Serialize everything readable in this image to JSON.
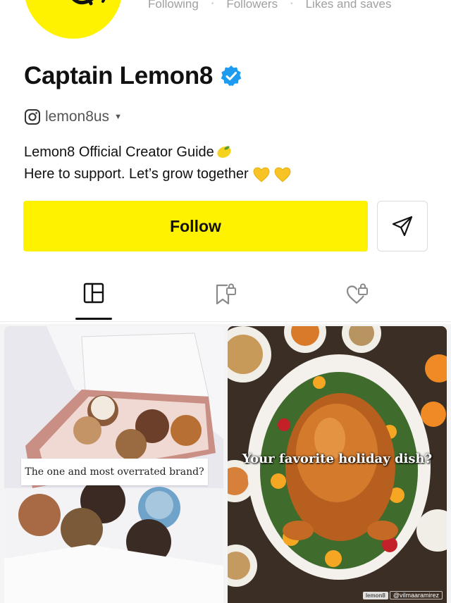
{
  "profile": {
    "name": "Captain Lemon8",
    "handle": "lemon8us",
    "bio_line1": "Lemon8 Official Creator Guide",
    "bio_line2": "Here to support. Let’s grow together",
    "verified": true,
    "avatar_color": "#fef200"
  },
  "stats": {
    "following_label": "Following",
    "followers_label": "Followers",
    "likes_label": "Likes and saves"
  },
  "actions": {
    "follow_label": "Follow",
    "follow_color": "#fef200"
  },
  "tabs": [
    {
      "name": "posts",
      "icon": "grid-icon",
      "active": true
    },
    {
      "name": "saved",
      "icon": "locked-bookmark-icon",
      "active": false
    },
    {
      "name": "liked",
      "icon": "locked-heart-icon",
      "active": false
    }
  ],
  "posts": [
    {
      "caption": "The one and most overrated brand?"
    },
    {
      "caption": "Your favorite holiday dish?",
      "watermark_user": "@vilmaaramirez"
    }
  ]
}
